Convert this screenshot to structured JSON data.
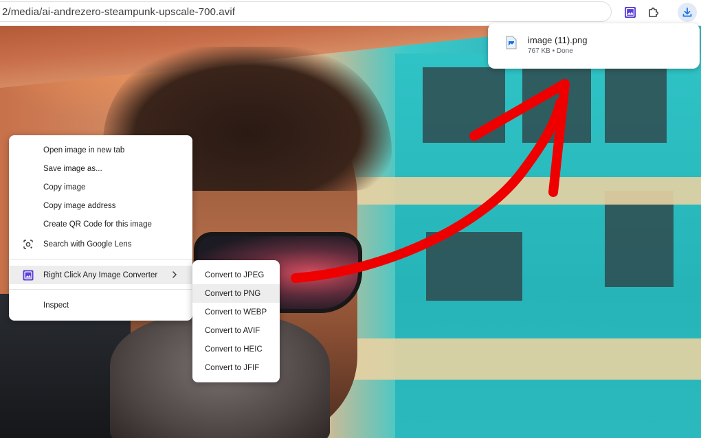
{
  "browser": {
    "url": "2/media/ai-andrezero-steampunk-upscale-700.avif",
    "toolbar": {
      "extension_icon": "image-converter-icon",
      "extensions_icon": "puzzle-icon",
      "downloads_icon": "download-icon"
    }
  },
  "download_popup": {
    "file_name": "image (11).png",
    "status": "767 KB • Done",
    "file_icon": "file-image-icon"
  },
  "context_menu": {
    "items": [
      {
        "label": "Open image in new tab"
      },
      {
        "label": "Save image as..."
      },
      {
        "label": "Copy image"
      },
      {
        "label": "Copy image address"
      },
      {
        "label": "Create QR Code for this image"
      },
      {
        "label": "Search with Google Lens",
        "icon": "google-lens-icon"
      },
      {
        "label": "Right Click Any Image Converter",
        "icon": "image-converter-icon",
        "submenu": true
      },
      {
        "label": "Inspect"
      }
    ]
  },
  "submenu": {
    "items": [
      {
        "label": "Convert to JPEG"
      },
      {
        "label": "Convert to PNG"
      },
      {
        "label": "Convert to WEBP"
      },
      {
        "label": "Convert to AVIF"
      },
      {
        "label": "Convert to HEIC"
      },
      {
        "label": "Convert to JFIF"
      }
    ]
  },
  "colors": {
    "accent_download": "#1a73e8",
    "arrow": "#ee0000",
    "extension_purple": "#5b3fd6"
  }
}
